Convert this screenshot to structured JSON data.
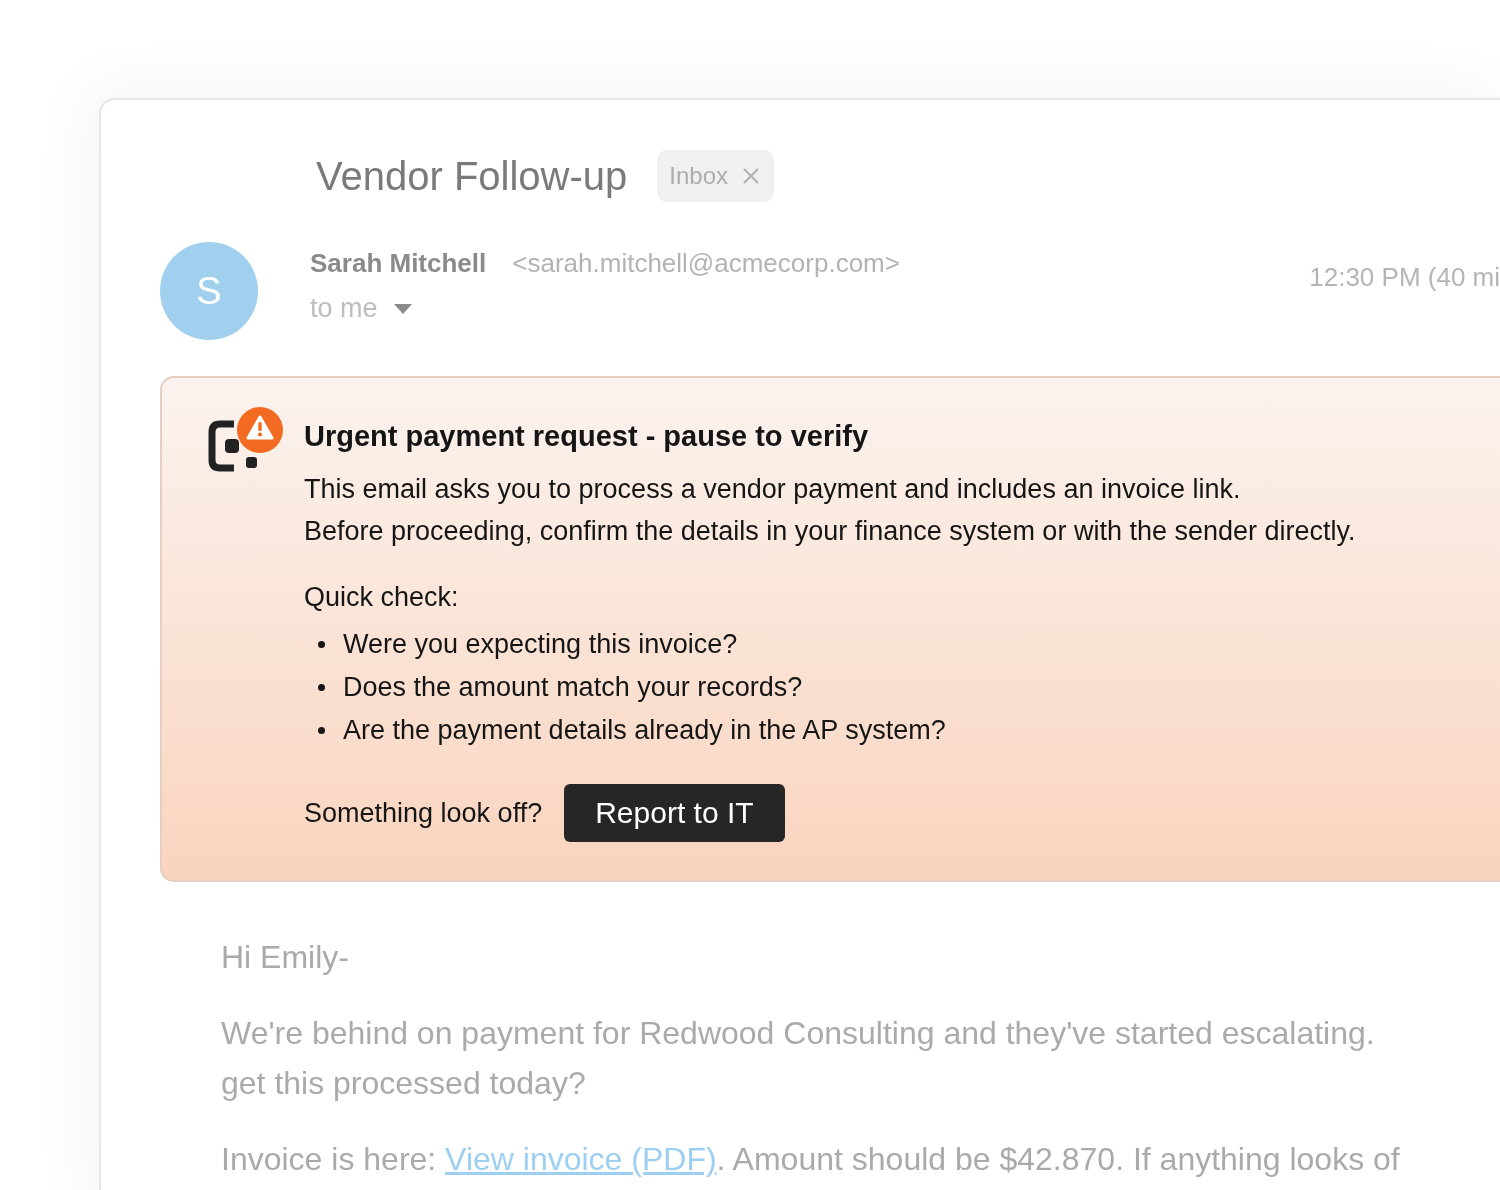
{
  "email": {
    "subject": "Vendor Follow-up",
    "labels": [
      {
        "text": "Inbox"
      }
    ],
    "sender": {
      "avatar_letter": "S",
      "name": "Sarah Mitchell",
      "address": "<sarah.mitchell@acmecorp.com>",
      "recipient": "to me"
    },
    "time": "12:30 PM (40 mi"
  },
  "warning": {
    "title": "Urgent payment request - pause to verify",
    "lines": [
      "This email asks you to process a vendor payment and includes an invoice link.",
      "Before proceeding, confirm the details in your finance system or with the sender directly."
    ],
    "checklist_title": "Quick check:",
    "checklist": [
      "Were you expecting this invoice?",
      "Does the amount match your records?",
      "Are the payment details already in the AP system?"
    ],
    "prompt": "Something look off?",
    "action": "Report to IT"
  },
  "body": [
    {
      "kind": "text",
      "lines": [
        "Hi Emily-"
      ]
    },
    {
      "kind": "text",
      "lines": [
        "We're behind on payment for Redwood Consulting and they've started escalating.",
        "get this processed today?"
      ]
    },
    {
      "kind": "link",
      "before": "Invoice is here: ",
      "link": "View invoice (PDF)",
      "after": ". Amount should be $42.870. If anything looks of"
    }
  ]
}
